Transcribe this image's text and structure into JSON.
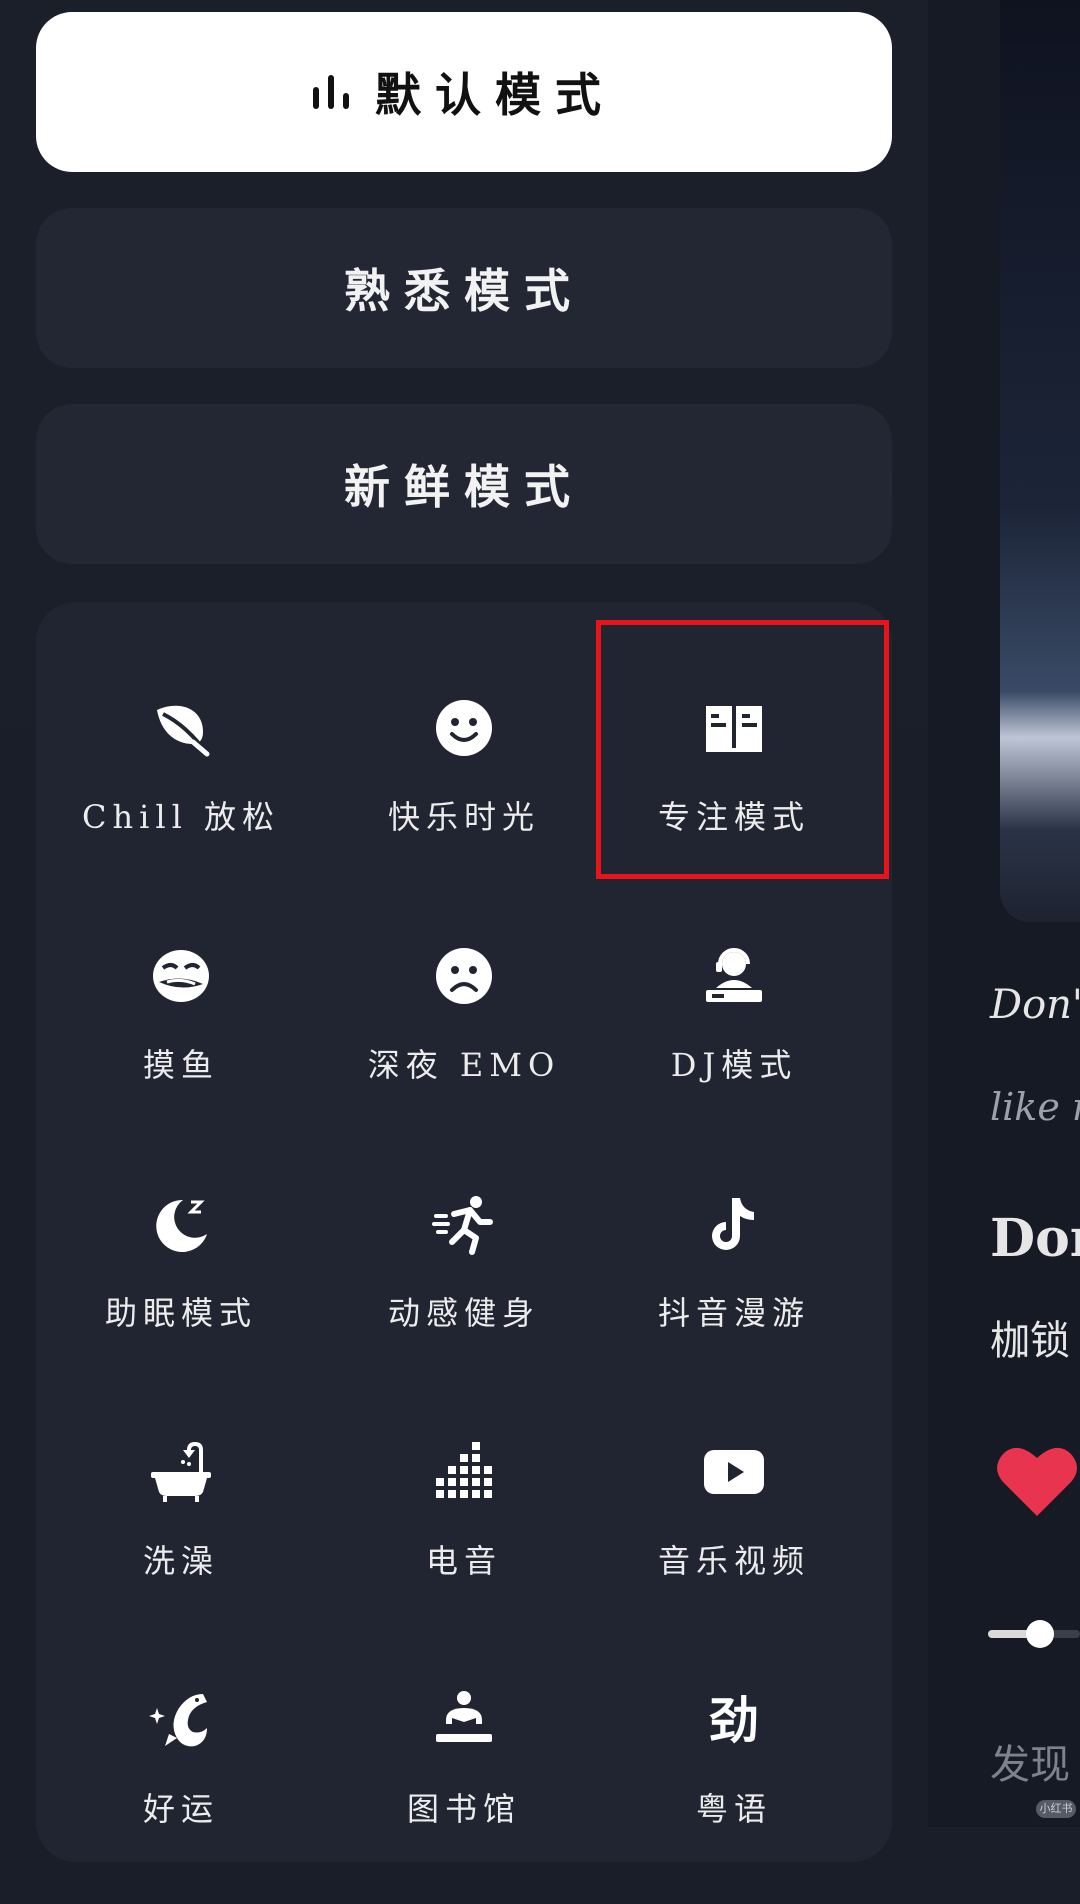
{
  "modes": {
    "default_label": "默认模式",
    "familiar_label": "熟悉模式",
    "fresh_label": "新鲜模式"
  },
  "grid": {
    "items": [
      {
        "label": "Chill 放松",
        "icon": "leaf-icon"
      },
      {
        "label": "快乐时光",
        "icon": "smile-icon"
      },
      {
        "label": "专注模式",
        "icon": "book-icon"
      },
      {
        "label": "摸鱼",
        "icon": "fish-face-icon"
      },
      {
        "label": "深夜 EMO",
        "icon": "sad-face-icon"
      },
      {
        "label": "DJ模式",
        "icon": "dj-icon"
      },
      {
        "label": "助眠模式",
        "icon": "moon-sleep-icon"
      },
      {
        "label": "动感健身",
        "icon": "running-icon"
      },
      {
        "label": "抖音漫游",
        "icon": "tiktok-icon"
      },
      {
        "label": "洗澡",
        "icon": "bathtub-icon"
      },
      {
        "label": "电音",
        "icon": "equalizer-icon"
      },
      {
        "label": "音乐视频",
        "icon": "video-play-icon"
      },
      {
        "label": "好运",
        "icon": "koi-fish-icon"
      },
      {
        "label": "图书馆",
        "icon": "library-reading-icon"
      },
      {
        "label": "粤语",
        "icon": "jin-character-icon"
      }
    ]
  },
  "right_panel": {
    "line1": "Don't",
    "line2": "like r",
    "line3": "Don",
    "line4": "枷锁",
    "discover": "发现",
    "badge": "小红书"
  },
  "colors": {
    "highlight": "#e8141a",
    "heart": "#e8344e",
    "background": "#1a1e28"
  }
}
